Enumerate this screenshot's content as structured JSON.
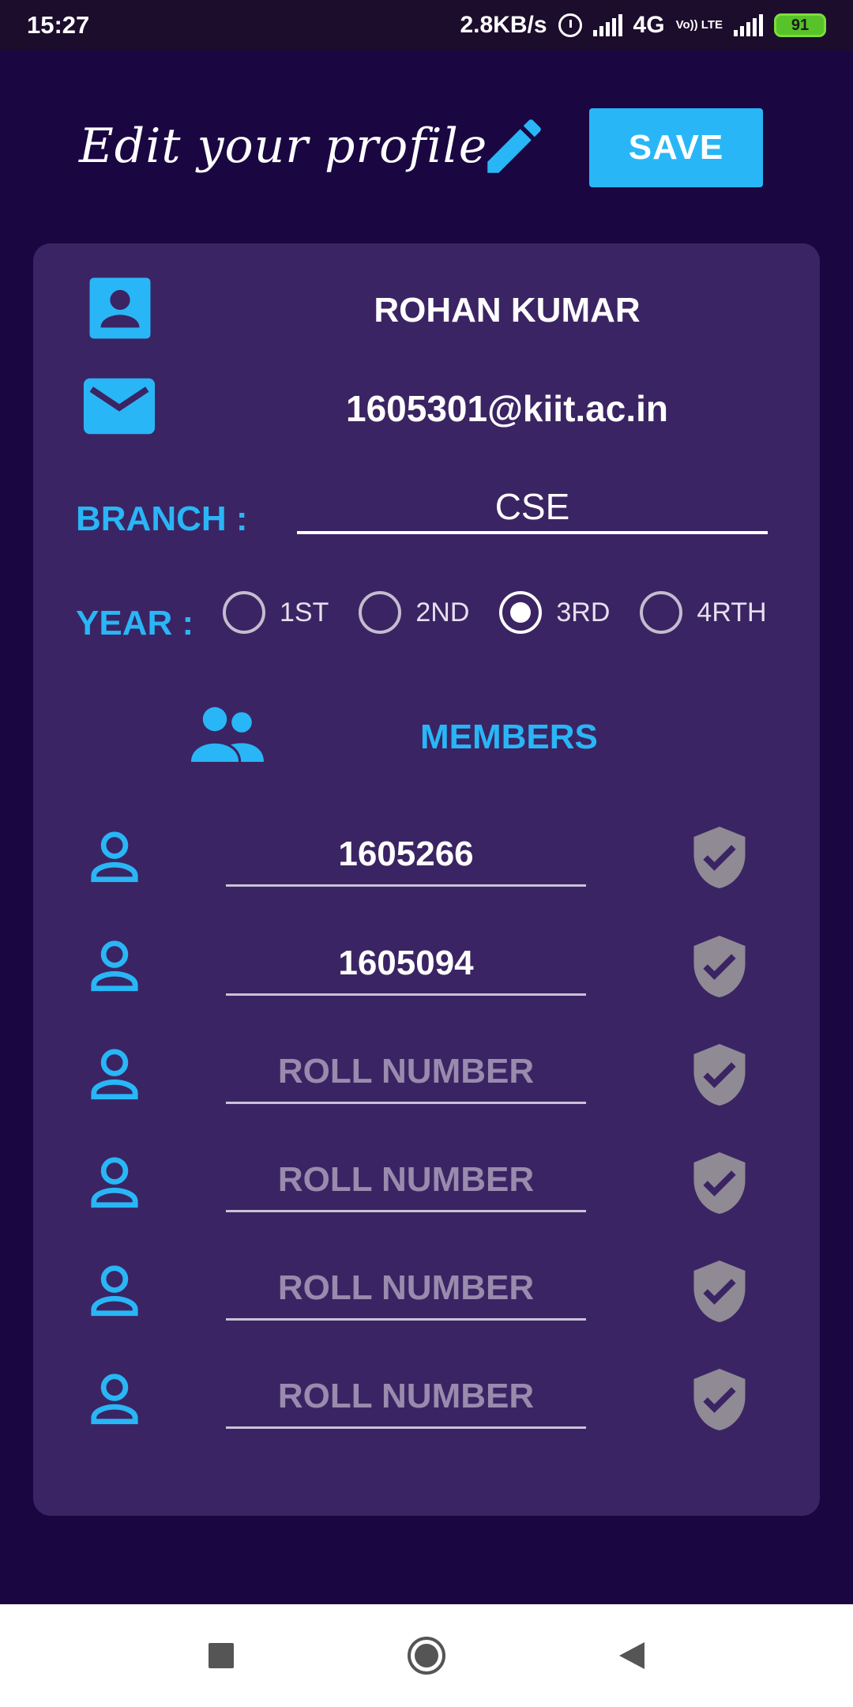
{
  "status_bar": {
    "time": "15:27",
    "net_speed": "2.8KB/s",
    "network": "4G",
    "volte": "Vo)) LTE",
    "battery": "91"
  },
  "header": {
    "title": "Edit your profile.",
    "save_label": "SAVE"
  },
  "profile": {
    "name": "ROHAN KUMAR",
    "email": "1605301@kiit.ac.in",
    "branch_label": "BRANCH :",
    "branch_value": "CSE",
    "year_label": "YEAR :",
    "year_options": [
      "1ST",
      "2ND",
      "3RD",
      "4RTH"
    ],
    "year_selected": "3RD"
  },
  "members": {
    "label": "MEMBERS",
    "placeholder": "ROLL NUMBER",
    "rows": [
      {
        "value": "1605266"
      },
      {
        "value": "1605094"
      },
      {
        "value": ""
      },
      {
        "value": ""
      },
      {
        "value": ""
      },
      {
        "value": ""
      }
    ]
  },
  "colors": {
    "background": "#1a0742",
    "card": "#3b2463",
    "accent": "#29b6f6",
    "shield": "#8f8a94"
  }
}
